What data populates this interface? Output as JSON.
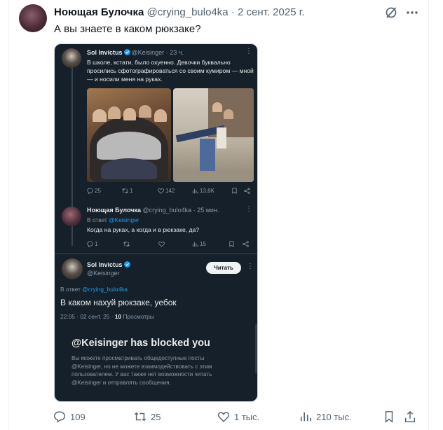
{
  "post": {
    "author_name": "Ноющая Булочка",
    "author_handle": "@crying_bulo4ka",
    "separator": "·",
    "date": "2 сент. 2025 г.",
    "text": "А вы знаете в каком рюкзаке?",
    "icons": {
      "grok": "grok-icon",
      "more": "more-icon"
    }
  },
  "screenshot": {
    "tweet1": {
      "author_name": "Sol Invictus",
      "author_handle": "@Keisinger",
      "time": "· 23 ч.",
      "text": "В школе, кстати, было охуенно. Девочки буквально просились сфотографироваться со своим кумиром — мной — и носили меня на руках.",
      "stats": {
        "replies": "25",
        "reposts": "1",
        "likes": "142",
        "views": "13,8K"
      }
    },
    "tweet2": {
      "author_name": "Ноющая Булочка",
      "author_handle": "@crying_bulo4ka",
      "time": "· 25 мин.",
      "reply_prefix": "В ответ",
      "reply_to": "@Keisinger",
      "text": "Когда на руках, а когда и в рюкзаке, да?",
      "stats": {
        "replies": "1",
        "views": "15"
      }
    },
    "tweet3": {
      "author_name": "Sol Invictus",
      "author_handle": "@Keisinger",
      "read_button": "Читать",
      "reply_prefix": "В ответ",
      "reply_to": "@crying_bulo4ka",
      "text": "В каком нахуй рюкзаке, уебок",
      "time_line": "22:05 · 02 сент. 25 ·",
      "views_count": "10",
      "views_label": "Просмотры"
    },
    "blocked": {
      "title": "@Keisinger has blocked you",
      "description": "Вы можете просматривать общедоступные посты @Keisinger, но не можете взаимодействовать с этим пользователем. У вас также нет возможности читать @Keisinger и отправлять сообщения."
    }
  },
  "actions": {
    "replies": "109",
    "reposts": "25",
    "likes": "1 тыс.",
    "views": "210 тыс."
  },
  "colors": {
    "accent": "#1d9bf0",
    "dark_bg": "#15202b",
    "muted": "#536471"
  }
}
